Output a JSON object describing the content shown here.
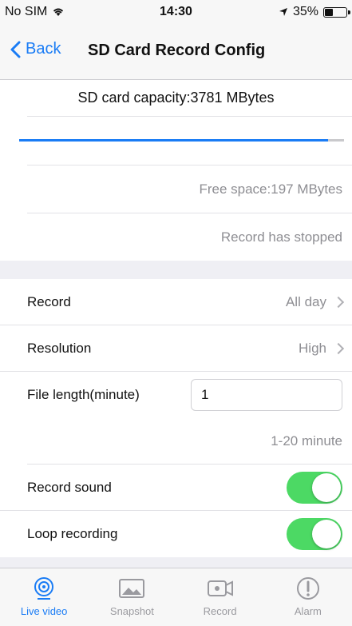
{
  "status": {
    "carrier": "No SIM",
    "time": "14:30",
    "battery": "35%",
    "battery_level": 0.35
  },
  "nav": {
    "back_label": "Back",
    "title": "SD Card Record Config"
  },
  "storage": {
    "capacity_text": "SD card capacity:3781 MBytes",
    "used_fraction": 0.95,
    "free_text": "Free space:197 MBytes",
    "status_text": "Record has stopped"
  },
  "settings": {
    "record": {
      "label": "Record",
      "value": "All day"
    },
    "resolution": {
      "label": "Resolution",
      "value": "High"
    },
    "file_length": {
      "label": "File length(minute)",
      "value": "1",
      "hint": "1-20 minute"
    },
    "record_sound": {
      "label": "Record sound",
      "on": true
    },
    "loop_recording": {
      "label": "Loop recording",
      "on": true
    }
  },
  "tabs": [
    {
      "label": "Live video",
      "icon": "live-video-icon",
      "active": true
    },
    {
      "label": "Snapshot",
      "icon": "snapshot-icon",
      "active": false
    },
    {
      "label": "Record",
      "icon": "record-icon",
      "active": false
    },
    {
      "label": "Alarm",
      "icon": "alarm-icon",
      "active": false
    }
  ],
  "colors": {
    "accent": "#1a7cf5",
    "toggle_on": "#4cd964",
    "secondary_text": "#8e8e93"
  }
}
